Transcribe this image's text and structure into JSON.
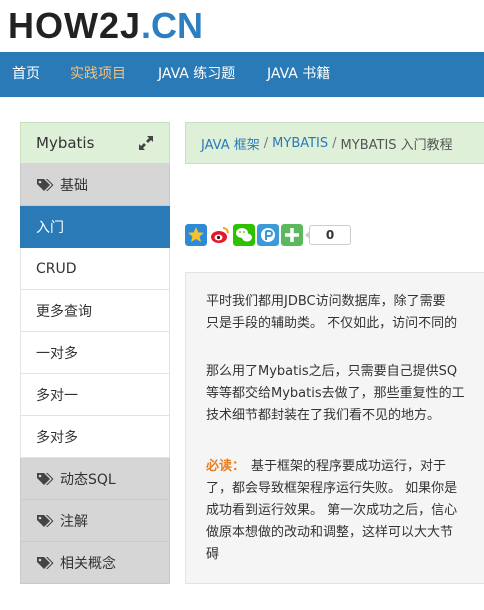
{
  "logo": {
    "brand": "HOW2J",
    "tld": ".CN"
  },
  "nav": {
    "items": [
      {
        "label": "首页",
        "active": false
      },
      {
        "label": "实践项目",
        "active": true
      },
      {
        "label": "JAVA 练习题",
        "active": false
      },
      {
        "label": "JAVA 书籍",
        "active": false
      }
    ]
  },
  "sidebar": {
    "header": "Mybatis",
    "items": [
      {
        "label": "基础",
        "type": "group"
      },
      {
        "label": "入门",
        "type": "active"
      },
      {
        "label": "CRUD",
        "type": "item"
      },
      {
        "label": "更多查询",
        "type": "item"
      },
      {
        "label": "一对多",
        "type": "item"
      },
      {
        "label": "多对一",
        "type": "item"
      },
      {
        "label": "多对多",
        "type": "item"
      },
      {
        "label": "动态SQL",
        "type": "group"
      },
      {
        "label": "注解",
        "type": "group"
      },
      {
        "label": "相关概念",
        "type": "group"
      }
    ]
  },
  "breadcrumb": {
    "part1": "JAVA 框架",
    "part2": "MYBATIS",
    "part3": "MYBATIS 入门教程"
  },
  "share": {
    "count": "0"
  },
  "content": {
    "p1_line1": "平时我们都用JDBC访问数据库，除了需要",
    "p1_line2": "只是手段的辅助类。 不仅如此，访问不同的",
    "p2_line1": "那么用了Mybatis之后，只需要自己提供SQ",
    "p2_line2": "等等都交给Mybatis去做了，那些重复性的工",
    "p2_line3": "技术细节都封装在了我们看不见的地方。",
    "p3_highlight": "必读：",
    "p3_line1": "基于框架的程序要成功运行，对于",
    "p3_line2": "了，都会导致框架程序运行失败。 如果你是",
    "p3_line3": "成功看到运行效果。 第一次成功之后，信心",
    "p3_line4": "做原本想做的改动和调整，这样可以大大节",
    "p3_line5": "碍"
  }
}
